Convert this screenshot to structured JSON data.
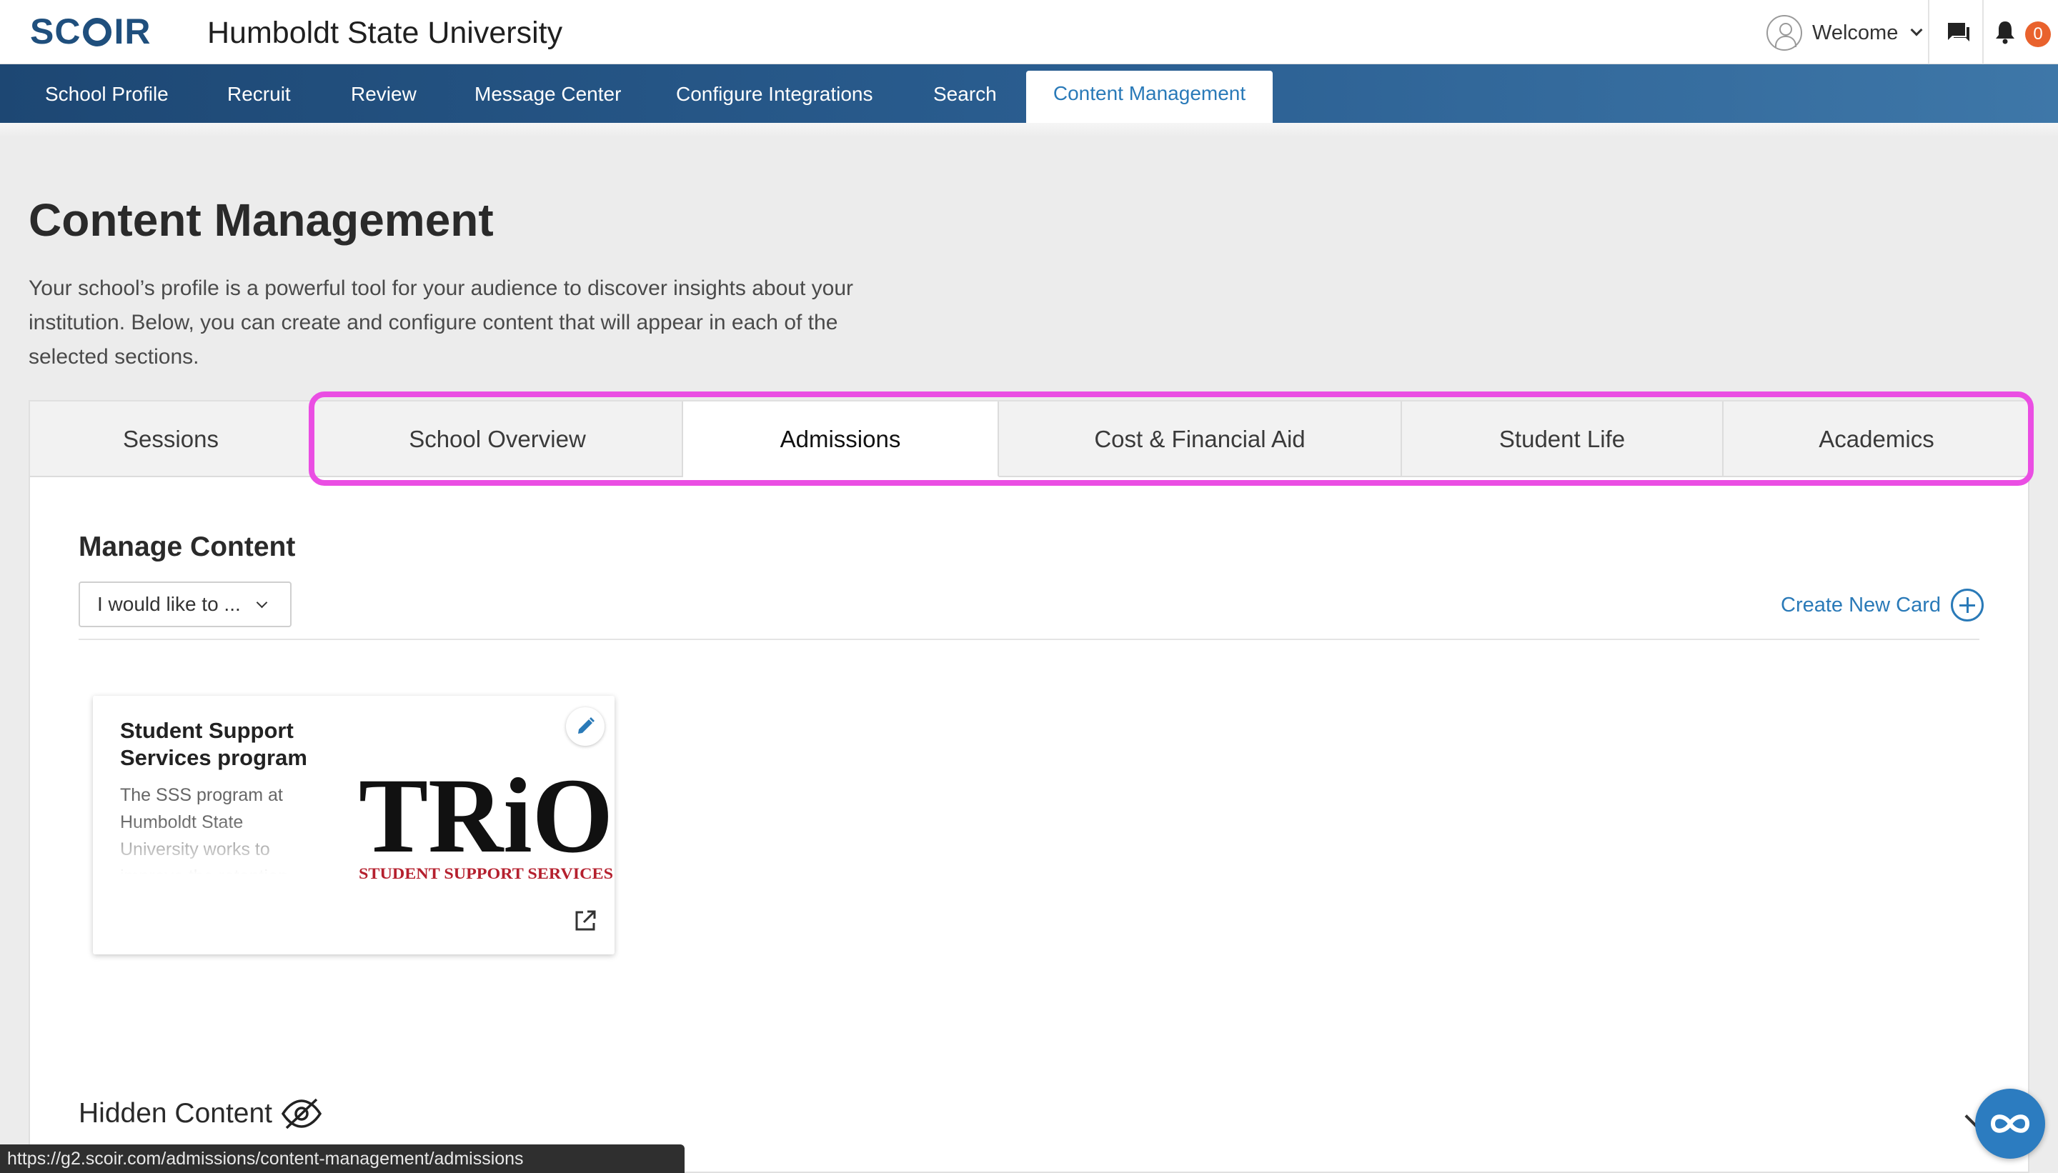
{
  "header": {
    "logo_text": "SCOIR",
    "school_name": "Humboldt State University",
    "welcome_label": "Welcome",
    "notification_count": "0"
  },
  "nav": {
    "items": [
      {
        "label": "School Profile"
      },
      {
        "label": "Recruit"
      },
      {
        "label": "Review"
      },
      {
        "label": "Message Center"
      },
      {
        "label": "Configure Integrations"
      },
      {
        "label": "Search"
      },
      {
        "label": "Content Management",
        "active": true
      }
    ]
  },
  "page": {
    "title": "Content Management",
    "description": "Your school’s profile is a powerful tool for your audience to discover insights about your institution. Below, you can create and configure content that will appear in each of the selected sections."
  },
  "tabs": [
    {
      "label": "Sessions"
    },
    {
      "label": "School Overview"
    },
    {
      "label": "Admissions",
      "active": true
    },
    {
      "label": "Cost & Financial Aid"
    },
    {
      "label": "Student Life"
    },
    {
      "label": "Academics"
    }
  ],
  "manage": {
    "title": "Manage Content",
    "dropdown_label": "I would like to ...",
    "create_label": "Create New Card"
  },
  "card": {
    "title": "Student Support Services program",
    "description": "The SSS program at Humboldt State University works to improve the retention",
    "logo_text": "TRiO",
    "logo_subtext": "STUDENT SUPPORT SERVICES"
  },
  "hidden": {
    "title": "Hidden Content"
  },
  "status_url": "https://g2.scoir.com/admissions/content-management/admissions",
  "colors": {
    "accent": "#2a7ab8",
    "nav_dark": "#1d4773",
    "highlight": "#ea4ee3",
    "badge": "#e9622d",
    "trio_red": "#b5202e"
  }
}
